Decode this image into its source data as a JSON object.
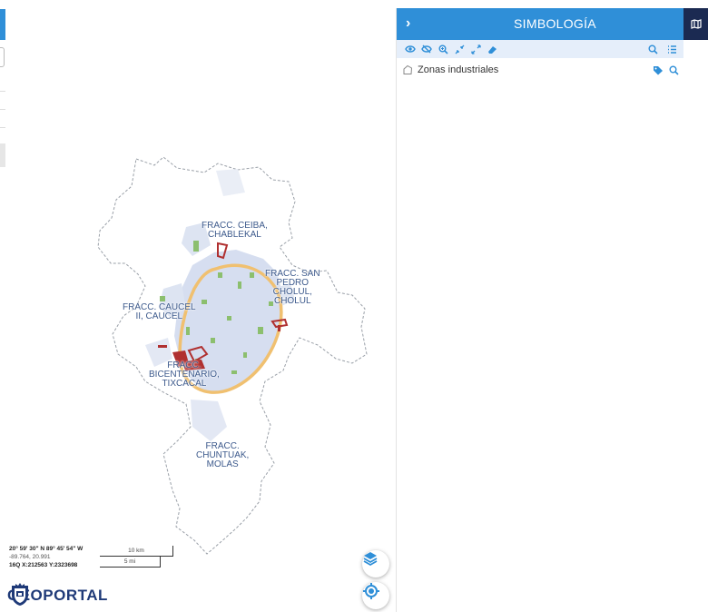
{
  "map": {
    "labels": [
      {
        "id": "ceiba",
        "text": "FRACC. CEIBA,\nCHABLEKAL"
      },
      {
        "id": "sanpedro",
        "text": "FRACC. SAN\nPEDRO\nCHOLUL,\nCHOLUL"
      },
      {
        "id": "caucel",
        "text": "FRACC. CAUCEL\nII, CAUCEL"
      },
      {
        "id": "bicentenario",
        "text": "FRACC.\nBICENTENARIO,\nTIXCACAL"
      },
      {
        "id": "chuntuak",
        "text": "FRACC.\nCHUNTUAK,\nMOLAS"
      }
    ],
    "coords": {
      "dms": "20° 59' 30\" N 89° 45' 54\" W",
      "decimal": "-89.764, 20.991",
      "utm": "16Q X:212563 Y:2323698"
    },
    "scale": {
      "km": "10 km",
      "mi": "5 mi"
    },
    "brand": "GEOPORTAL",
    "buttons": {
      "layers_icon": "layers-icon",
      "locate_icon": "locate-icon"
    }
  },
  "panel": {
    "title": "SIMBOLOGÍA",
    "collapse_icon": "chevron-right-icon",
    "toolbar_left": [
      "eye-icon",
      "eye-off-icon",
      "zoom-in-icon",
      "collapse-icon",
      "expand-icon",
      "eraser-icon"
    ],
    "toolbar_right": [
      "search-icon",
      "list-icon"
    ],
    "layers": [
      {
        "name": "Zonas industriales",
        "icon": "polygon-icon",
        "actions": [
          "tag-icon",
          "zoom-icon"
        ]
      }
    ]
  },
  "side_tab": {
    "icon": "map-icon"
  },
  "colors": {
    "accent": "#2f8fd8",
    "dark": "#1b2a52",
    "brand": "#1f3a78",
    "ring": "#f0c070",
    "zone": "#b03030",
    "green": "#8cbf6e",
    "urban": "#d6def0"
  }
}
